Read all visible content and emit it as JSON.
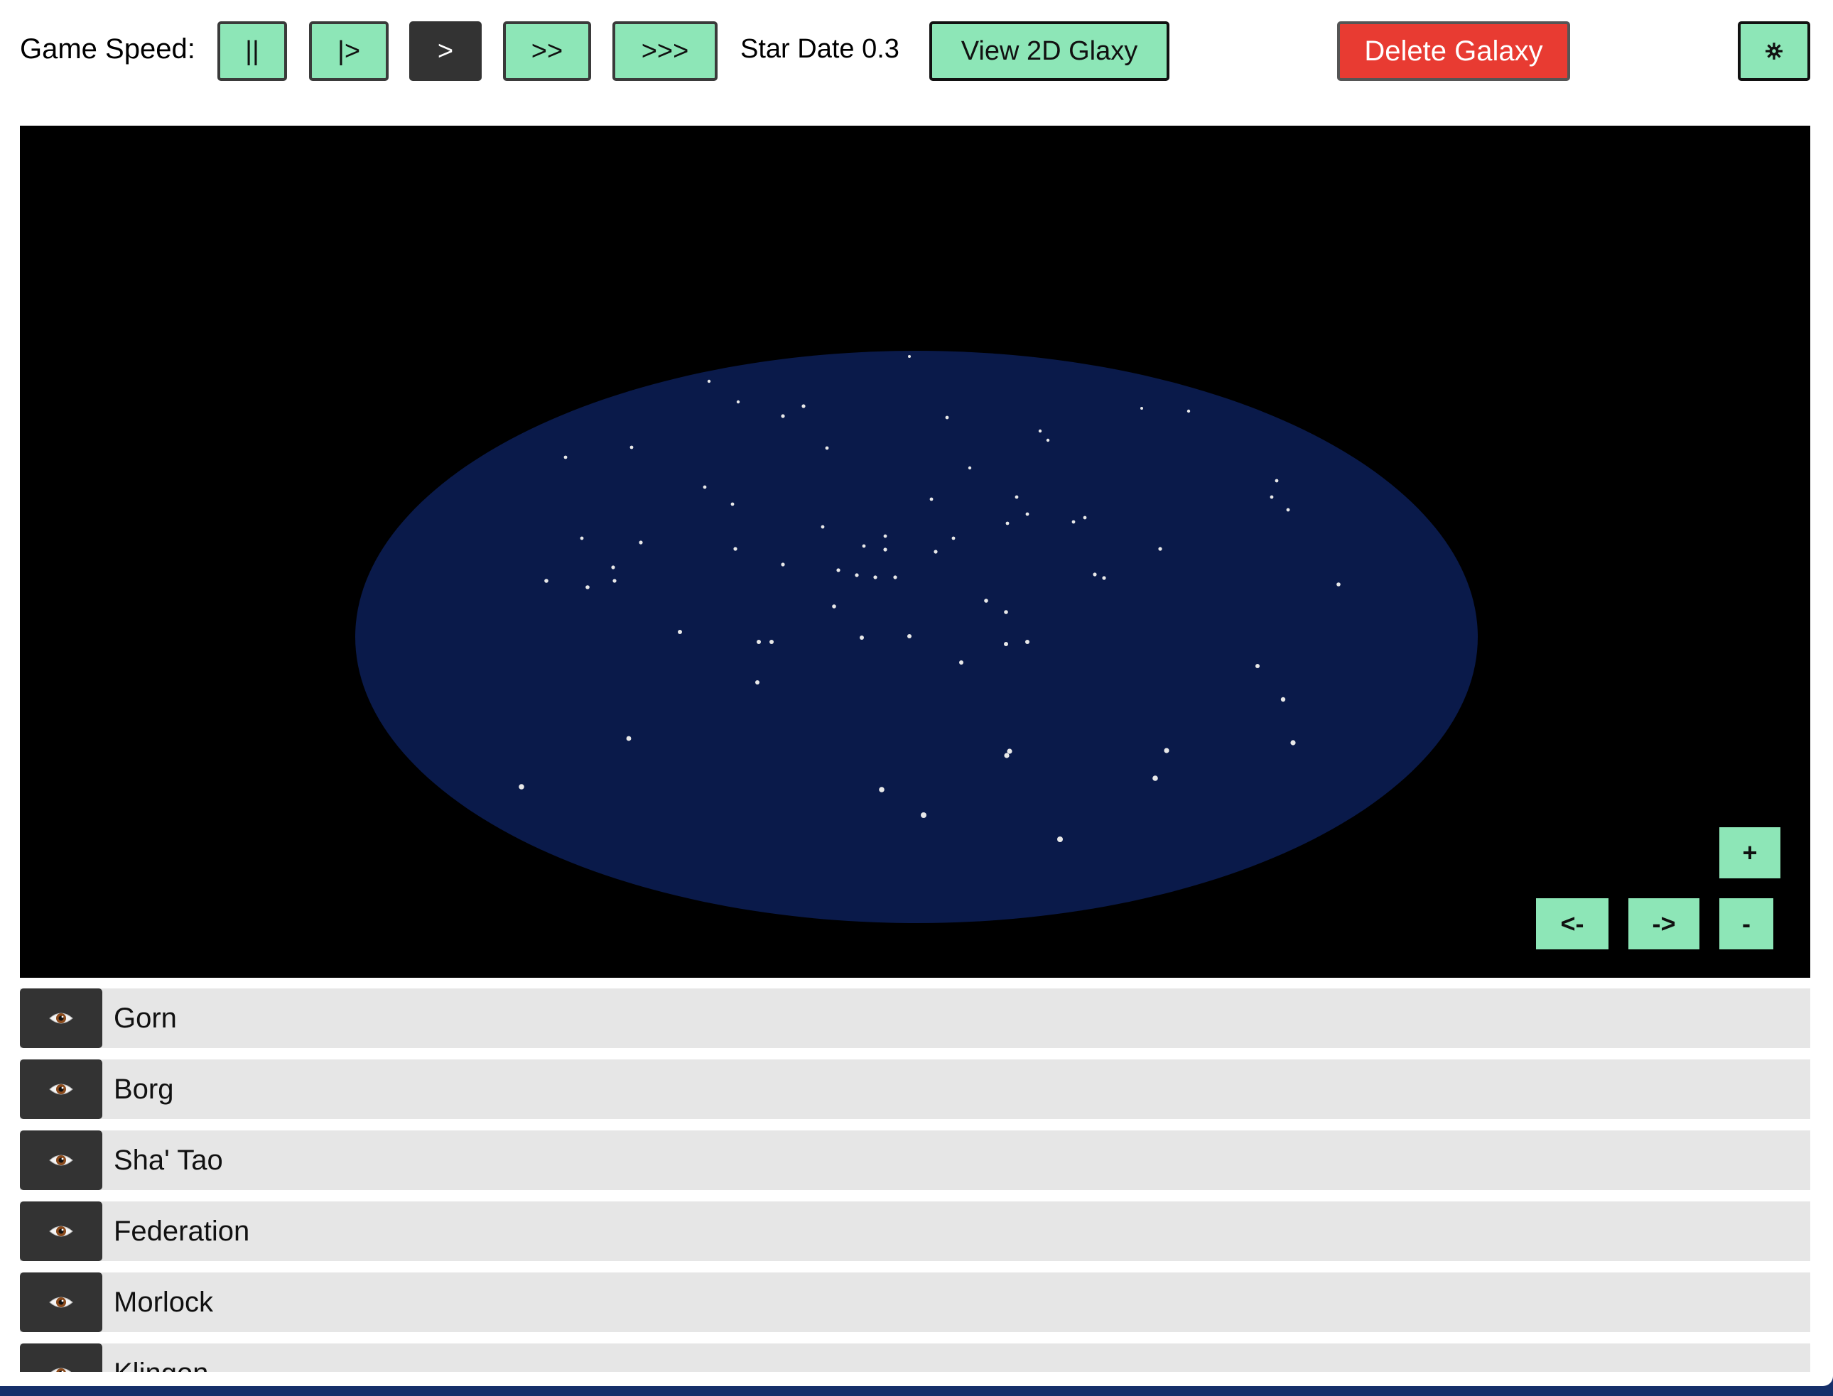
{
  "toolbar": {
    "game_speed_label": "Game Speed:",
    "speed_buttons": [
      {
        "label": "||",
        "active": false
      },
      {
        "label": "|>",
        "active": false
      },
      {
        "label": ">",
        "active": true
      },
      {
        "label": ">>",
        "active": false
      },
      {
        "label": ">>>",
        "active": false
      }
    ],
    "star_date": "Star Date 0.3",
    "view_2d_label": "View 2D Glaxy",
    "delete_label": "Delete Galaxy",
    "settings_icon": "gear-icon"
  },
  "galaxy_view": {
    "zoom_in_label": "+",
    "zoom_out_label": "-",
    "rotate_left_label": "<-",
    "rotate_right_label": "->",
    "disc_color": "#0a1a4a",
    "background_color": "#000000",
    "star_color": "#e8e8e8"
  },
  "empires": [
    {
      "name": "Gorn",
      "icon": "eye-icon"
    },
    {
      "name": "Borg",
      "icon": "eye-icon"
    },
    {
      "name": "Sha' Tao",
      "icon": "eye-icon"
    },
    {
      "name": "Federation",
      "icon": "eye-icon"
    },
    {
      "name": "Morlock",
      "icon": "eye-icon"
    },
    {
      "name": "Klingon",
      "icon": "eye-icon"
    }
  ],
  "colors": {
    "button_accent": "#8de6b7",
    "button_active": "#333333",
    "danger": "#e83b32",
    "row_background": "#e6e6e6"
  }
}
